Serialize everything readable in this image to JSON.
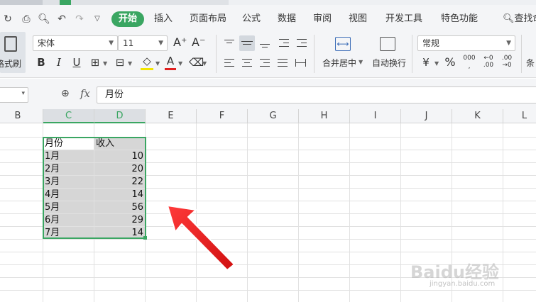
{
  "menu": {
    "start": "开始",
    "items": [
      "插入",
      "页面布局",
      "公式",
      "数据",
      "审阅",
      "视图",
      "开发工具",
      "特色功能"
    ],
    "search": "查找命令"
  },
  "ribbon": {
    "format_painter": "格式刷",
    "font_name": "宋体",
    "font_size": "11",
    "bold": "B",
    "italic": "I",
    "underline": "U",
    "font_color_letter": "A",
    "grow_font": "A⁺",
    "shrink_font": "A⁻",
    "merge_center": "合并居中",
    "wrap_text": "自动换行",
    "number_format": "常规",
    "percent": "%",
    "thousands": "000",
    "dec_inc_top": "←0",
    "dec_inc_bot": ".00",
    "dec_dec_top": ".00",
    "dec_dec_bot": "→0",
    "cond": "条",
    "accent": "#3aa662"
  },
  "formula_bar": {
    "fx": "fx",
    "value": "月份"
  },
  "sheet": {
    "columns": [
      "B",
      "C",
      "D",
      "E",
      "F",
      "G",
      "H",
      "I",
      "J",
      "K",
      "L"
    ],
    "selected_columns": [
      "C",
      "D"
    ],
    "header_row": [
      "月份",
      "收入"
    ],
    "rows": [
      [
        "1月",
        "10"
      ],
      [
        "2月",
        "20"
      ],
      [
        "3月",
        "22"
      ],
      [
        "4月",
        "14"
      ],
      [
        "5月",
        "56"
      ],
      [
        "6月",
        "29"
      ],
      [
        "7月",
        "14"
      ]
    ]
  },
  "watermark": {
    "brand": "Baidu经验",
    "url": "jingyan.baidu.com"
  }
}
